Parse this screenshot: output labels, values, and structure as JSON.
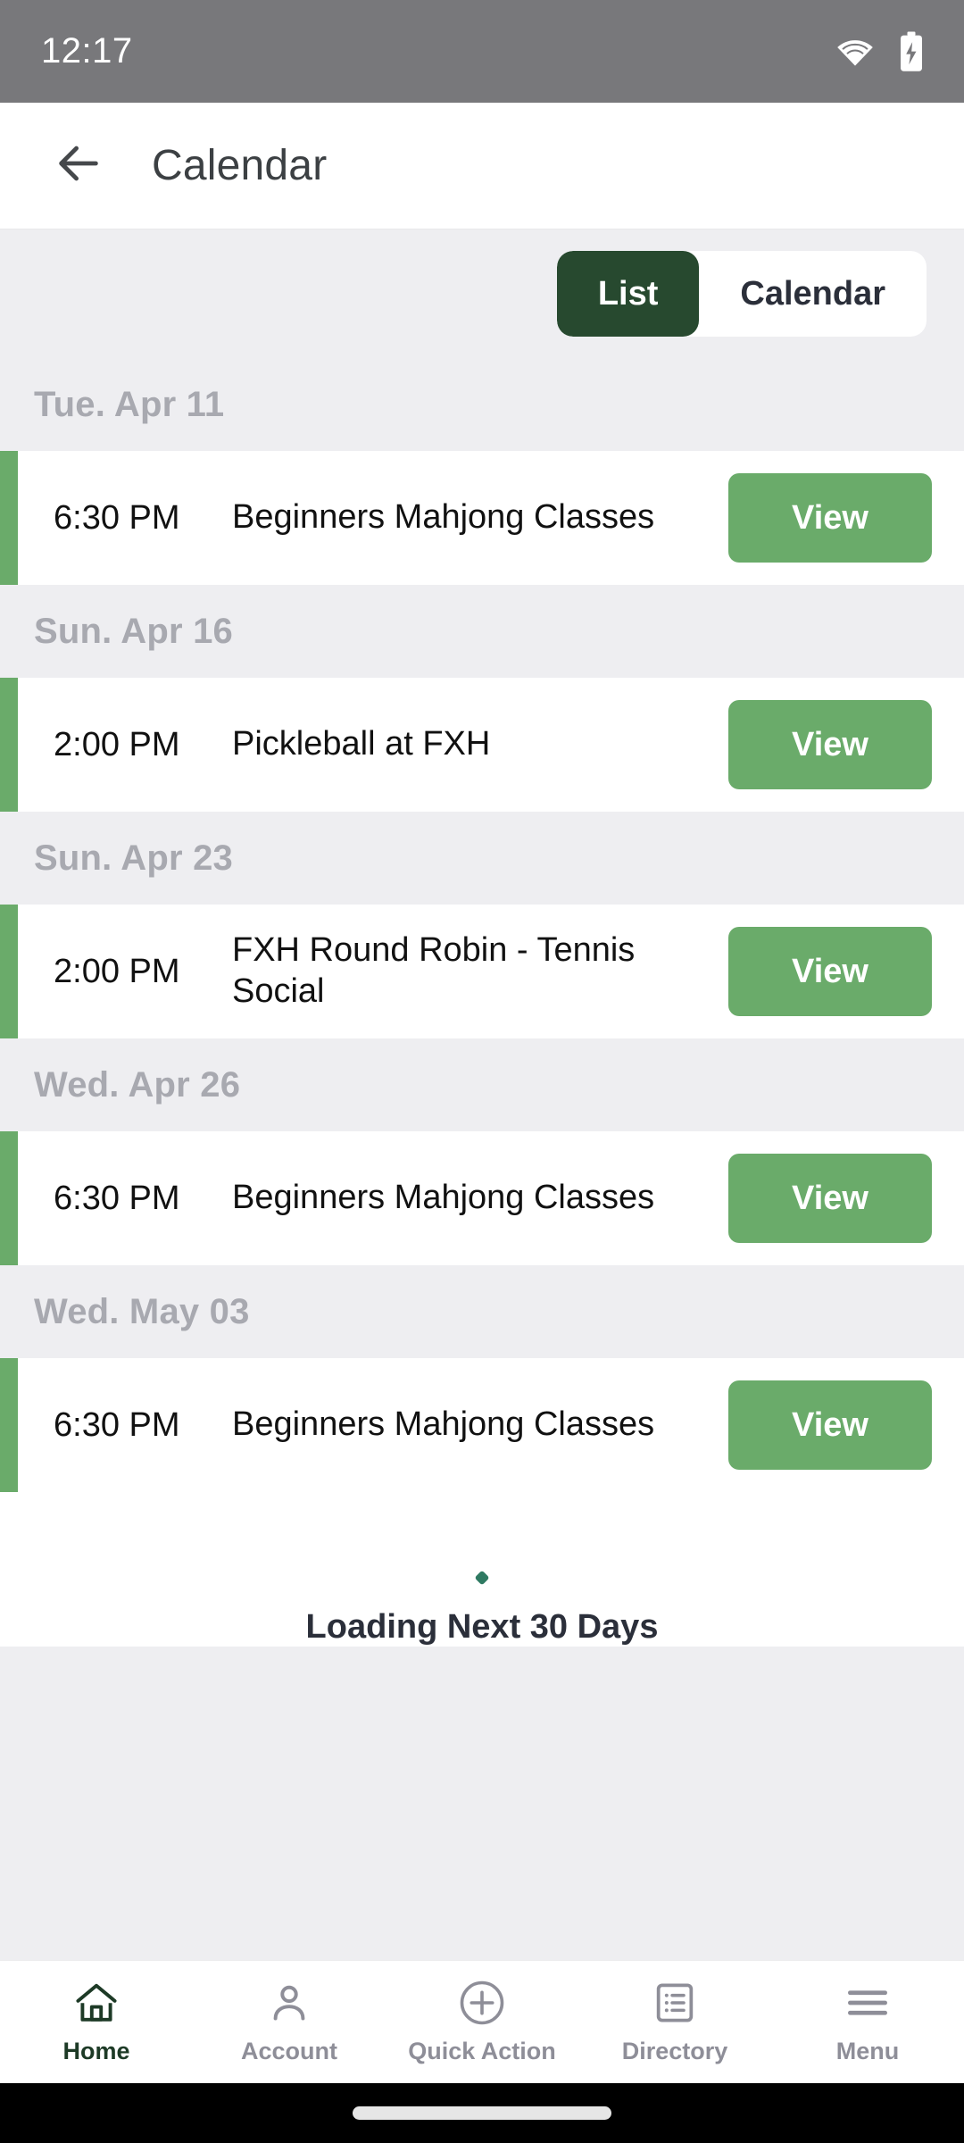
{
  "status_bar": {
    "time": "12:17",
    "wifi_icon": "wifi-icon",
    "battery_icon": "battery-charging-icon"
  },
  "header": {
    "back_icon": "back-arrow-icon",
    "title": "Calendar"
  },
  "view_toggle": {
    "options": [
      {
        "label": "List",
        "active": true
      },
      {
        "label": "Calendar",
        "active": false
      }
    ],
    "active_color": "#27492f",
    "inactive_bg": "#ffffff"
  },
  "groups": [
    {
      "date_label": "Tue. Apr 11",
      "events": [
        {
          "time": "6:30 PM",
          "title": "Beginners Mahjong Classes",
          "action": "View"
        }
      ]
    },
    {
      "date_label": "Sun. Apr 16",
      "events": [
        {
          "time": "2:00 PM",
          "title": "Pickleball at FXH",
          "action": "View"
        }
      ]
    },
    {
      "date_label": "Sun. Apr 23",
      "events": [
        {
          "time": "2:00 PM",
          "title": "FXH Round Robin - Tennis Social",
          "action": "View"
        }
      ]
    },
    {
      "date_label": "Wed. Apr 26",
      "events": [
        {
          "time": "6:30 PM",
          "title": "Beginners Mahjong Classes",
          "action": "View"
        }
      ]
    },
    {
      "date_label": "Wed. May 03",
      "events": [
        {
          "time": "6:30 PM",
          "title": "Beginners Mahjong Classes",
          "action": "View"
        }
      ]
    }
  ],
  "loading": {
    "text": "Loading Next 30 Days",
    "spinner_color": "#2f7a62"
  },
  "bottom_nav": [
    {
      "label": "Home",
      "icon": "home-icon",
      "active": true
    },
    {
      "label": "Account",
      "icon": "person-icon",
      "active": false
    },
    {
      "label": "Quick Action",
      "icon": "plus-circle-icon",
      "active": false
    },
    {
      "label": "Directory",
      "icon": "list-document-icon",
      "active": false
    },
    {
      "label": "Menu",
      "icon": "hamburger-icon",
      "active": false
    }
  ],
  "colors": {
    "accent_green": "#6aab6a",
    "dark_green": "#27492f",
    "page_bg": "#eeeef1",
    "date_text": "#a8a9b0",
    "status_bg": "#78787b"
  }
}
